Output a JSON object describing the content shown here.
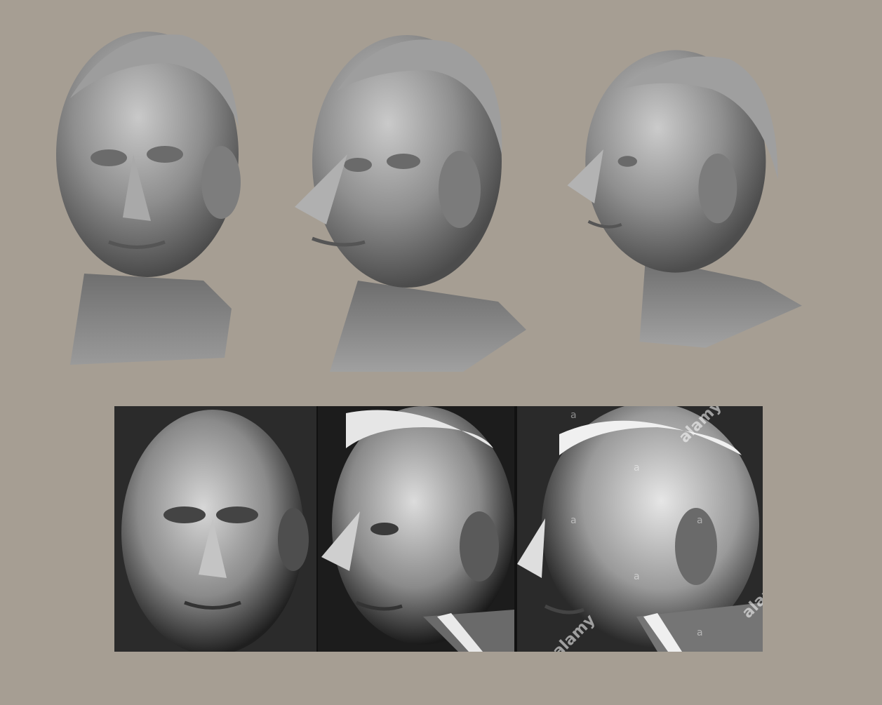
{
  "scene": {
    "background_color": "#a69e93",
    "sculpt_color": "#8a8a8a",
    "renders": [
      {
        "view": "front"
      },
      {
        "view": "three-quarter"
      },
      {
        "view": "profile"
      }
    ],
    "photos": [
      {
        "view": "front"
      },
      {
        "view": "three-quarter"
      },
      {
        "view": "profile"
      }
    ],
    "watermark": {
      "brand": "alamy",
      "mark": "a"
    }
  }
}
